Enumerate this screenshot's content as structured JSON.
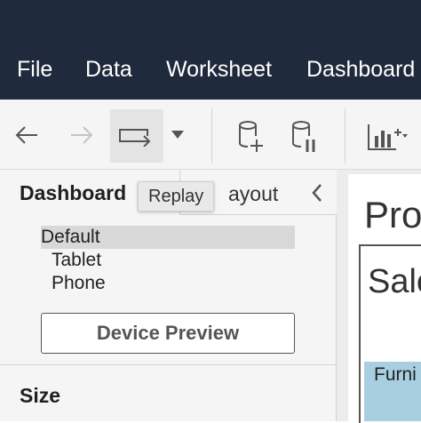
{
  "menu": {
    "file": "File",
    "data": "Data",
    "worksheet": "Worksheet",
    "dashboard": "Dashboard"
  },
  "toolbar": {
    "replay_tooltip": "Replay"
  },
  "left_pane": {
    "tabs": [
      "Dashboard",
      "Layout"
    ],
    "layout_visible_text": "ayout",
    "devices": [
      "Default",
      "Tablet",
      "Phone"
    ],
    "selected_device": "Default",
    "device_preview_label": "Device Preview",
    "size_label": "Size"
  },
  "canvas": {
    "dashboard_title_partial": "Pro",
    "sheet_title_partial": "Sale",
    "category_partial": "Furni"
  },
  "colors": {
    "titlebar": "#1f2a3d",
    "toolbar_bg": "#f5f5f5",
    "category_fill": "#a8cfe0"
  }
}
